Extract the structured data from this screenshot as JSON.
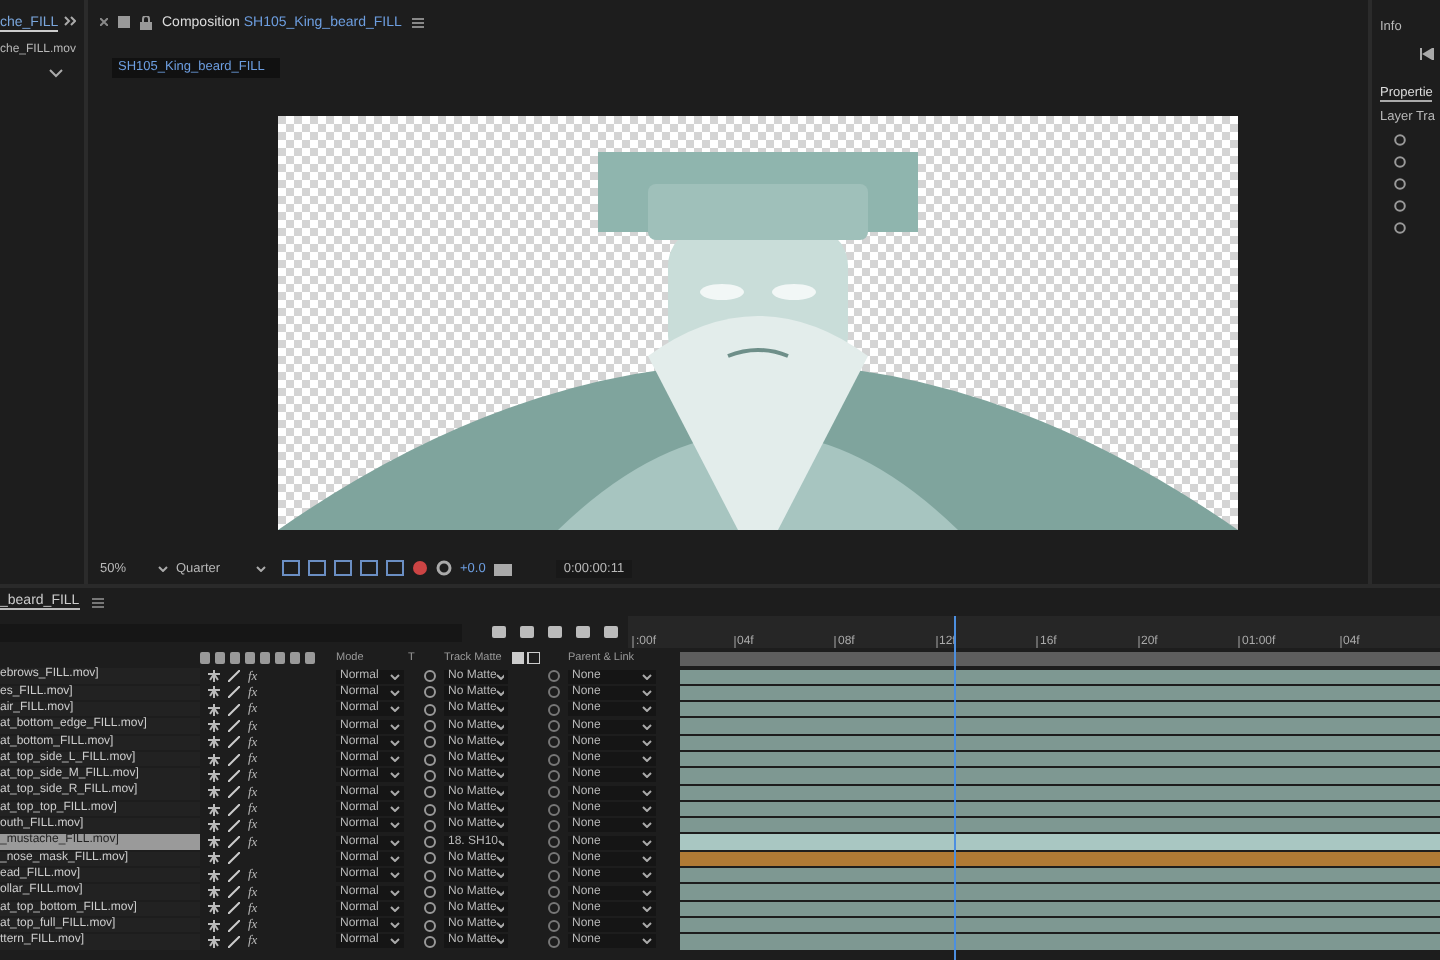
{
  "left_panel": {
    "tab": "che_FILL",
    "item": "che_FILL.mov"
  },
  "composition_panel": {
    "tab_prefix": "Composition",
    "tab_name": "SH105_King_beard_FILL",
    "subtab": "SH105_King_beard_FILL",
    "zoom": "50%",
    "resolution": "Quarter",
    "exposure": "+0.0",
    "timecode": "0:00:00:11"
  },
  "right_panel": {
    "info_tab": "Info",
    "properties_tab": "Propertie",
    "section": "Layer Tra"
  },
  "timeline": {
    "tab": "_beard_FILL",
    "headers": {
      "mode": "Mode",
      "t": "T",
      "track_matte": "Track Matte",
      "parent": "Parent & Link"
    },
    "ruler": [
      ":00f",
      "04f",
      "08f",
      "12f",
      "16f",
      "20f",
      "01:00f",
      "04f"
    ],
    "layers": [
      {
        "name": "ebrows_FILL.mov]",
        "fx": "fx",
        "mode": "Normal",
        "track_matte": "No Matte",
        "parent": "None",
        "selected": false,
        "color": "#7e9892"
      },
      {
        "name": "es_FILL.mov]",
        "fx": "fx",
        "mode": "Normal",
        "track_matte": "No Matte",
        "parent": "None",
        "selected": false,
        "color": "#7e9892"
      },
      {
        "name": "air_FILL.mov]",
        "fx": "fx",
        "mode": "Normal",
        "track_matte": "No Matte",
        "parent": "None",
        "selected": false,
        "color": "#7e9892"
      },
      {
        "name": "at_bottom_edge_FILL.mov]",
        "fx": "fx",
        "mode": "Normal",
        "track_matte": "No Matte",
        "parent": "None",
        "selected": false,
        "color": "#7e9892"
      },
      {
        "name": "at_bottom_FILL.mov]",
        "fx": "fx",
        "mode": "Normal",
        "track_matte": "No Matte",
        "parent": "None",
        "selected": false,
        "color": "#7e9892"
      },
      {
        "name": "at_top_side_L_FILL.mov]",
        "fx": "fx",
        "mode": "Normal",
        "track_matte": "No Matte",
        "parent": "None",
        "selected": false,
        "color": "#7e9892"
      },
      {
        "name": "at_top_side_M_FILL.mov]",
        "fx": "fx",
        "mode": "Normal",
        "track_matte": "No Matte",
        "parent": "None",
        "selected": false,
        "color": "#7e9892"
      },
      {
        "name": "at_top_side_R_FILL.mov]",
        "fx": "fx",
        "mode": "Normal",
        "track_matte": "No Matte",
        "parent": "None",
        "selected": false,
        "color": "#7e9892"
      },
      {
        "name": "at_top_top_FILL.mov]",
        "fx": "fx",
        "mode": "Normal",
        "track_matte": "No Matte",
        "parent": "None",
        "selected": false,
        "color": "#7e9892"
      },
      {
        "name": "outh_FILL.mov]",
        "fx": "fx",
        "mode": "Normal",
        "track_matte": "No Matte",
        "parent": "None",
        "selected": false,
        "color": "#7e9892"
      },
      {
        "name": "_mustache_FILL.mov]",
        "fx": "fx",
        "mode": "Normal",
        "track_matte": "18. SH10",
        "parent": "None",
        "selected": true,
        "color": "#a9c7c2"
      },
      {
        "name": "_nose_mask_FILL.mov]",
        "mode": "Normal",
        "track_matte": "No Matte",
        "parent": "None",
        "selected": false,
        "color": "#b07a35"
      },
      {
        "name": "ead_FILL.mov]",
        "fx": "fx",
        "mode": "Normal",
        "track_matte": "No Matte",
        "parent": "None",
        "selected": false,
        "color": "#7e9892"
      },
      {
        "name": "ollar_FILL.mov]",
        "fx": "fx",
        "mode": "Normal",
        "track_matte": "No Matte",
        "parent": "None",
        "selected": false,
        "color": "#7e9892"
      },
      {
        "name": "at_top_bottom_FILL.mov]",
        "fx": "fx",
        "mode": "Normal",
        "track_matte": "No Matte",
        "parent": "None",
        "selected": false,
        "color": "#7e9892"
      },
      {
        "name": "at_top_full_FILL.mov]",
        "fx": "fx",
        "mode": "Normal",
        "track_matte": "No Matte",
        "parent": "None",
        "selected": false,
        "color": "#7e9892"
      },
      {
        "name": "ttern_FILL.mov]",
        "fx": "fx",
        "mode": "Normal",
        "track_matte": "No Matte",
        "parent": "None",
        "selected": false,
        "color": "#7e9892"
      }
    ]
  }
}
